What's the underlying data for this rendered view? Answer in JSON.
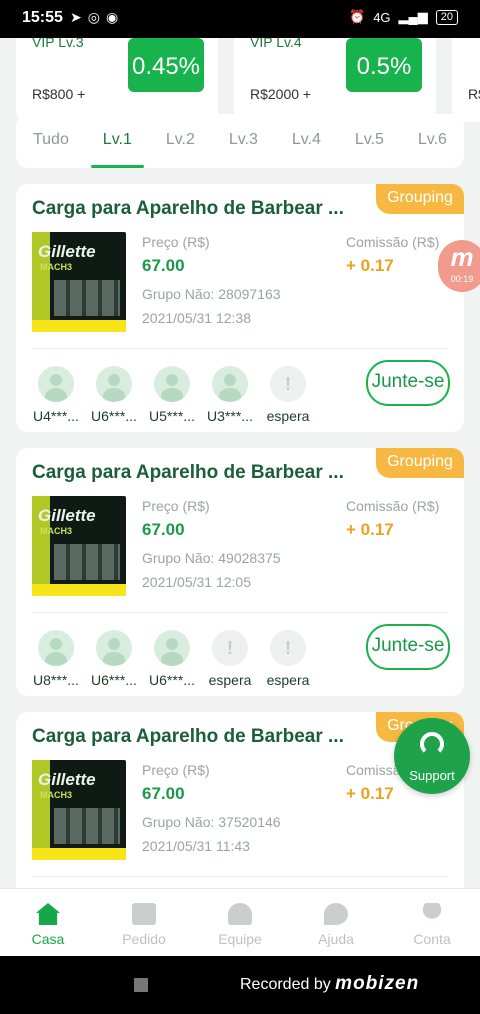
{
  "status_bar": {
    "time": "15:55",
    "left_icons": [
      "➤",
      "◎",
      "◉"
    ],
    "net": "4G",
    "battery": "20"
  },
  "vip_levels": [
    {
      "name": "VIP Lv.3",
      "amount": "R$800 +",
      "rate": "0.45%"
    },
    {
      "name": "VIP Lv.4",
      "amount": "R$2000 +",
      "rate": "0.5%"
    },
    {
      "name": "",
      "amount": "R$",
      "rate": ""
    }
  ],
  "tabs": [
    {
      "label": "Tudo",
      "active": false
    },
    {
      "label": "Lv.1",
      "active": true
    },
    {
      "label": "Lv.2",
      "active": false
    },
    {
      "label": "Lv.3",
      "active": false
    },
    {
      "label": "Lv.4",
      "active": false
    },
    {
      "label": "Lv.5",
      "active": false
    },
    {
      "label": "Lv.6",
      "active": false
    }
  ],
  "product_image": {
    "logo": "Gillette",
    "sub": "MACH3"
  },
  "cards": [
    {
      "badge": "Grouping",
      "title": "Carga para Aparelho de Barbear ...",
      "price_label": "Preço (R$)",
      "price": "67.00",
      "commission_label": "Comissão (R$)",
      "commission": "+ 0.17",
      "group": "Grupo Não: 28097163",
      "date": "2021/05/31 12:38",
      "members": [
        {
          "name": "U4***...",
          "waiting": false
        },
        {
          "name": "U6***...",
          "waiting": false
        },
        {
          "name": "U5***...",
          "waiting": false
        },
        {
          "name": "U3***...",
          "waiting": false
        },
        {
          "name": "espera",
          "waiting": true
        }
      ],
      "join_label": "Junte-se"
    },
    {
      "badge": "Grouping",
      "title": "Carga para Aparelho de Barbear ...",
      "price_label": "Preço (R$)",
      "price": "67.00",
      "commission_label": "Comissão (R$)",
      "commission": "+ 0.17",
      "group": "Grupo Não: 49028375",
      "date": "2021/05/31 12:05",
      "members": [
        {
          "name": "U8***...",
          "waiting": false
        },
        {
          "name": "U6***...",
          "waiting": false
        },
        {
          "name": "U6***...",
          "waiting": false
        },
        {
          "name": "espera",
          "waiting": true
        },
        {
          "name": "espera",
          "waiting": true
        }
      ],
      "join_label": "Junte-se"
    },
    {
      "badge": "Grouping",
      "title": "Carga para Aparelho de Barbear ...",
      "price_label": "Preço (R$)",
      "price": "67.00",
      "commission_label": "Comissão (R$)",
      "commission": "+ 0.17",
      "group": "Grupo Não: 37520146",
      "date": "2021/05/31 11:43",
      "members": [],
      "join_label": ""
    }
  ],
  "floating_recorder": {
    "letter": "m",
    "time": "00:19"
  },
  "support": {
    "label": "Support"
  },
  "bottom_nav": [
    {
      "label": "Casa",
      "icon": "home-icon",
      "active": true
    },
    {
      "label": "Pedido",
      "icon": "order-icon",
      "active": false
    },
    {
      "label": "Equipe",
      "icon": "team-icon",
      "active": false
    },
    {
      "label": "Ajuda",
      "icon": "help-icon",
      "active": false
    },
    {
      "label": "Conta",
      "icon": "user-icon",
      "active": false
    }
  ],
  "recorded": {
    "prefix": "Recorded by",
    "brand": "mobizen"
  },
  "colors": {
    "accent": "#18b34c",
    "badge": "#f6b840",
    "commission": "#f0a020",
    "title": "#1c5e3a"
  }
}
